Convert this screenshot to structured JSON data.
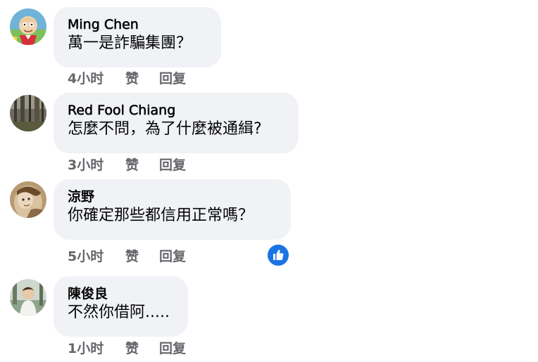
{
  "comments": [
    {
      "author": "Ming Chen",
      "text": "萬一是詐騙集團？",
      "time": "4小时",
      "like": "赞",
      "reply": "回复",
      "avatar_icon": "avatar-cartoon-icon"
    },
    {
      "author": "Red Fool Chiang",
      "text": "怎麼不問，為了什麼被通緝?",
      "time": "3小时",
      "like": "赞",
      "reply": "回复",
      "avatar_icon": "avatar-forest-icon"
    },
    {
      "author": "涼野",
      "text": "你確定那些都信用正常嗎？",
      "time": "5小时",
      "like": "赞",
      "reply": "回复",
      "avatar_icon": "avatar-painting-icon",
      "reaction": {
        "icon": "thumbs-up-icon",
        "color": "#1b74e4"
      }
    },
    {
      "author": "陳俊良",
      "text": "不然你借阿.....",
      "time": "1小时",
      "like": "赞",
      "reply": "回复",
      "avatar_icon": "avatar-photo-icon"
    }
  ],
  "colors": {
    "bubble_background": "#f0f2f5",
    "text_primary": "#050505",
    "text_secondary": "#65676b",
    "accent": "#1b74e4"
  }
}
